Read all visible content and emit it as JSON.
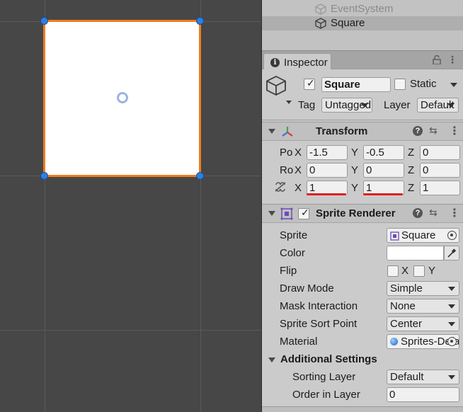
{
  "hierarchy": {
    "items": [
      {
        "label": "EventSystem"
      },
      {
        "label": "Square"
      }
    ]
  },
  "inspector": {
    "tab_label": "Inspector",
    "object": {
      "active": true,
      "name": "Square",
      "static_label": "Static",
      "static_checked": false,
      "tag_label": "Tag",
      "tag_value": "Untagged",
      "layer_label": "Layer",
      "layer_value": "Default"
    },
    "transform": {
      "title": "Transform",
      "position": {
        "label": "Po",
        "x": "-1.5",
        "y": "-0.5",
        "z": "0"
      },
      "rotation": {
        "label": "Ro",
        "x": "0",
        "y": "0",
        "z": "0"
      },
      "scale": {
        "x": "1",
        "y": "1",
        "z": "1"
      },
      "axis_x": "X",
      "axis_y": "Y",
      "axis_z": "Z"
    },
    "sprite_renderer": {
      "title": "Sprite Renderer",
      "enabled": true,
      "sprite_label": "Sprite",
      "sprite_value": "Square",
      "color_label": "Color",
      "color_value": "#ffffff",
      "flip_label": "Flip",
      "flip_x": "X",
      "flip_y": "Y",
      "draw_mode_label": "Draw Mode",
      "draw_mode_value": "Simple",
      "mask_label": "Mask Interaction",
      "mask_value": "None",
      "sort_point_label": "Sprite Sort Point",
      "sort_point_value": "Center",
      "material_label": "Material",
      "material_value": "Sprites-Default",
      "additional_title": "Additional Settings",
      "sorting_layer_label": "Sorting Layer",
      "sorting_layer_value": "Default",
      "order_label": "Order in Layer",
      "order_value": "0"
    }
  },
  "colors": {
    "selection_outline": "#f07c1e",
    "handle": "#2f7fe0",
    "annotation": "#e02020",
    "scene_bg": "#474747",
    "panel_bg": "#cbcbcb"
  }
}
